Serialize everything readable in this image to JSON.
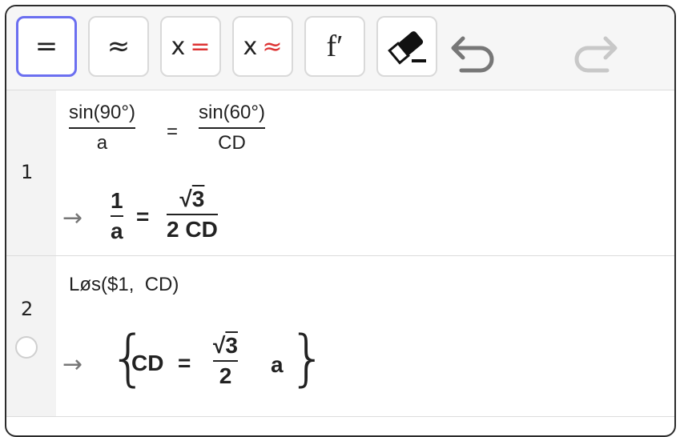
{
  "toolbar": {
    "buttons": [
      {
        "id": "evaluate",
        "symbol": "="
      },
      {
        "id": "numeric",
        "symbol": "≈"
      },
      {
        "id": "solve",
        "prefix": "x",
        "suffix": "="
      },
      {
        "id": "nsolve",
        "prefix": "x",
        "suffix": "≈"
      },
      {
        "id": "derivative",
        "symbol": "f′"
      }
    ],
    "icons": [
      "eraser-icon",
      "undo-icon",
      "redo-icon"
    ]
  },
  "rows": [
    {
      "number": "1",
      "input": {
        "lhs_num": "sin(90°)",
        "lhs_den": "a",
        "op": "=",
        "rhs_num": "sin(60°)",
        "rhs_den": "CD"
      },
      "output": {
        "arrow": "→",
        "lhs_num": "1",
        "lhs_den": "a",
        "op": "=",
        "rhs_radical": "3",
        "rhs_den": "2 CD"
      }
    },
    {
      "number": "2",
      "input": {
        "text": "Løs($1,  CD)"
      },
      "output": {
        "arrow": "→",
        "brace_open": "{",
        "var": "CD",
        "op": "=",
        "radical": "3",
        "den": "2",
        "tail": "a",
        "brace_close": "}"
      }
    }
  ],
  "colors": {
    "accent": "#6b6ff0",
    "red": "#d33333",
    "arrow": "#777777"
  }
}
